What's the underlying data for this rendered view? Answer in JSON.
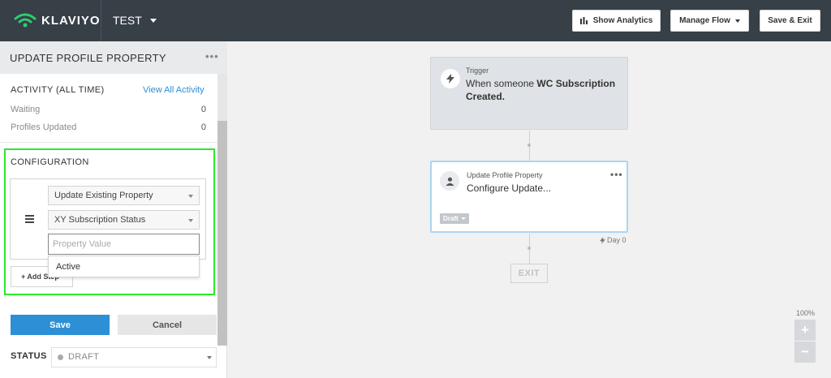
{
  "topbar": {
    "brand": "KLAVIYO",
    "flow_name": "TEST",
    "show_analytics": "Show Analytics",
    "manage_flow": "Manage Flow",
    "save_exit": "Save & Exit"
  },
  "panel": {
    "title": "UPDATE PROFILE PROPERTY",
    "activity_heading": "ACTIVITY (ALL TIME)",
    "view_all": "View All Activity",
    "stats": [
      {
        "label": "Waiting",
        "value": "0"
      },
      {
        "label": "Profiles Updated",
        "value": "0"
      }
    ],
    "config_heading": "CONFIGURATION",
    "action_select": "Update Existing Property",
    "property_select": "XY Subscription Status",
    "value_placeholder": "Property Value",
    "dropdown_option": "Active",
    "add_step": "+ Add Step",
    "save": "Save",
    "cancel": "Cancel",
    "status_label": "STATUS",
    "status_value": "DRAFT"
  },
  "canvas": {
    "trigger": {
      "label": "Trigger",
      "text_prefix": "When someone ",
      "text_bold": "WC Subscription Created."
    },
    "action": {
      "label": "Update Profile Property",
      "text": "Configure Update...",
      "badge": "Draft"
    },
    "delay": "Day 0",
    "exit": "EXIT",
    "zoom_level": "100%",
    "zoom_in": "+",
    "zoom_out": "−"
  },
  "colors": {
    "topbar": "#373f47",
    "accent": "#2d8fd5",
    "logo_green": "#2ecc71",
    "highlight": "#2ce82c"
  }
}
